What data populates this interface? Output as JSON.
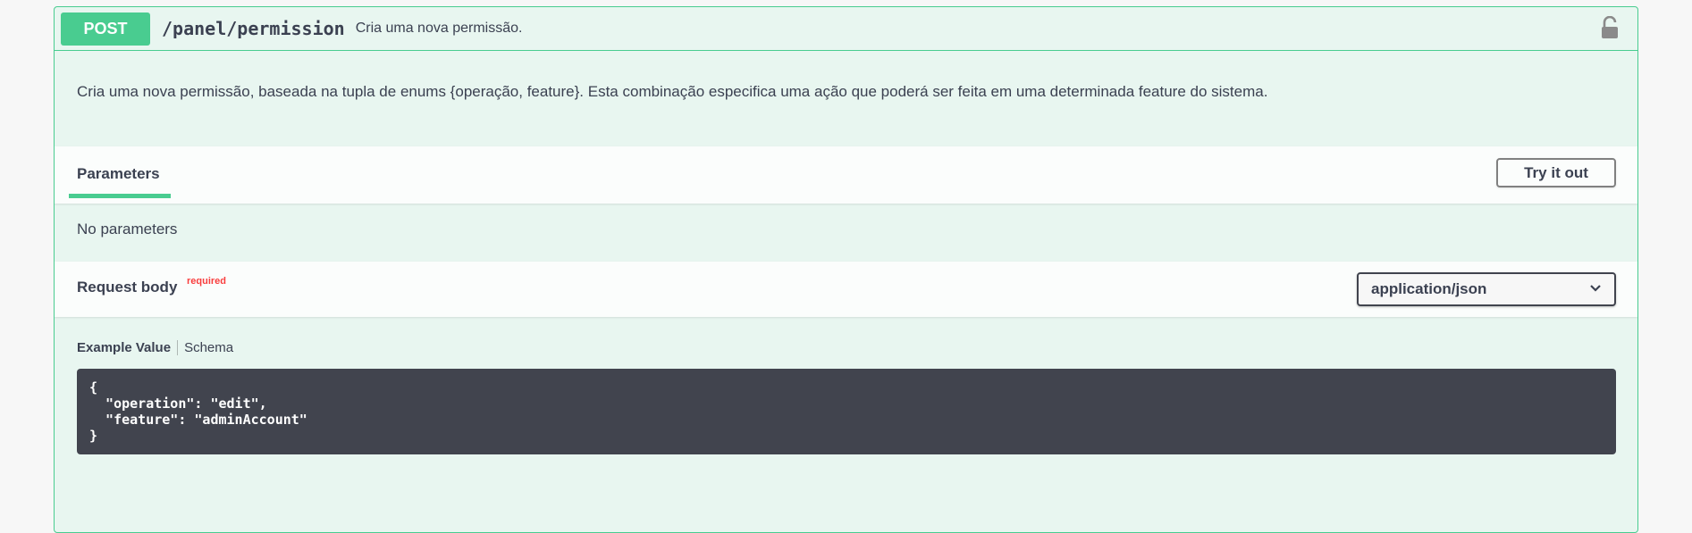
{
  "operation": {
    "method": "POST",
    "path": "/panel/permission",
    "summary": "Cria uma nova permissão.",
    "description": "Cria uma nova permissão, baseada na tupla de enums {operação, feature}. Esta combinação especifica uma ação que poderá ser feita em uma determinada feature do sistema."
  },
  "parameters": {
    "tab_label": "Parameters",
    "try_button": "Try it out",
    "empty_text": "No parameters"
  },
  "request_body": {
    "title": "Request body",
    "required_label": "required",
    "content_type": "application/json"
  },
  "model_tabs": {
    "example_label": "Example Value",
    "schema_label": "Schema"
  },
  "example_value": "{\n  \"operation\": \"edit\",\n  \"feature\": \"adminAccount\"\n}",
  "colors": {
    "accent": "#49cc90",
    "background": "#e8f6f0",
    "code_bg": "#41444e",
    "required": "#f93e3e"
  },
  "icons": {
    "lock": "unlocked-padlock-icon",
    "select_arrow": "chevron-down-icon"
  }
}
